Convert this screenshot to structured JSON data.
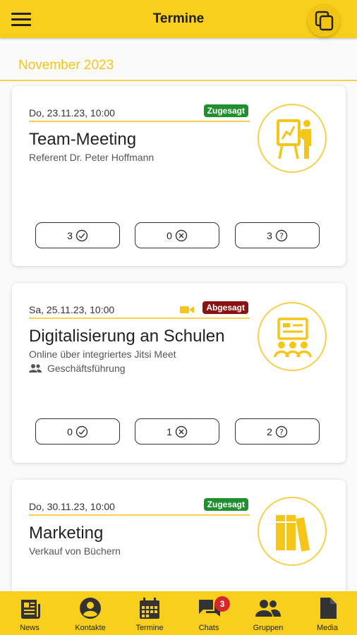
{
  "header": {
    "title": "Termine"
  },
  "month": "November 2023",
  "colors": {
    "accent": "#f7cf1c",
    "accepted": "#1f8f2f",
    "cancelled": "#8b1212"
  },
  "events": [
    {
      "date": "Do, 23.11.23, 10:00",
      "status": "Zugesagt",
      "title": "Team-Meeting",
      "subtitle": "Referent Dr. Peter Hoffmann",
      "icon": "presentation-icon",
      "responses": {
        "yes": "3",
        "no": "0",
        "maybe": "3"
      }
    },
    {
      "date": "Sa, 25.11.23, 10:00",
      "status": "Abgesagt",
      "title": "Digitalisierung an Schulen",
      "subtitle": "Online über integriertes Jitsi Meet",
      "group": "Geschäftsführung",
      "icon": "classroom-icon",
      "responses": {
        "yes": "0",
        "no": "1",
        "maybe": "2"
      }
    },
    {
      "date": "Do, 30.11.23, 10:00",
      "status": "Zugesagt",
      "title": "Marketing",
      "subtitle": "Verkauf von Büchern",
      "icon": "books-icon"
    }
  ],
  "bottom_nav": [
    {
      "label": "News",
      "icon": "news-icon"
    },
    {
      "label": "Kontakte",
      "icon": "contacts-icon"
    },
    {
      "label": "Termine",
      "icon": "calendar-icon"
    },
    {
      "label": "Chats",
      "icon": "chat-icon",
      "badge": "3"
    },
    {
      "label": "Gruppen",
      "icon": "groups-icon"
    },
    {
      "label": "Media",
      "icon": "document-icon"
    }
  ]
}
